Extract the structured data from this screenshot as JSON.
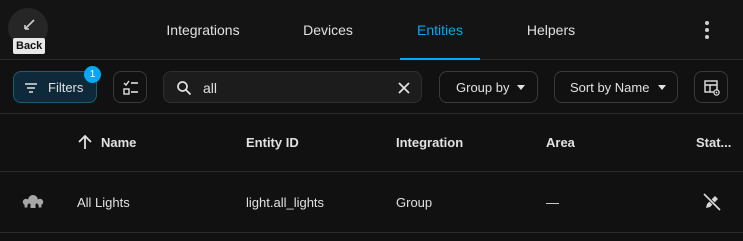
{
  "header": {
    "back_label": "Back",
    "tabs": [
      {
        "label": "Integrations",
        "active": false
      },
      {
        "label": "Devices",
        "active": false
      },
      {
        "label": "Entities",
        "active": true
      },
      {
        "label": "Helpers",
        "active": false
      }
    ],
    "more_icon": "dots-vertical-icon"
  },
  "toolbar": {
    "filters_label": "Filters",
    "filters_count": "1",
    "search": {
      "value": "all",
      "placeholder": "Search"
    },
    "group_by_label": "Group by",
    "sort_label": "Sort by Name"
  },
  "table": {
    "columns": [
      "Name",
      "Entity ID",
      "Integration",
      "Area",
      "Stat..."
    ],
    "sort_column": "Name",
    "sort_direction": "ascending",
    "rows": [
      {
        "icon": "lightbulb-group-icon",
        "name": "All Lights",
        "entity_id": "light.all_lights",
        "integration": "Group",
        "area": "—",
        "status_icon": "pencil-off-icon"
      }
    ]
  },
  "colors": {
    "accent": "#03a9f4",
    "background": "#111111",
    "text": "#e1e1e1"
  }
}
